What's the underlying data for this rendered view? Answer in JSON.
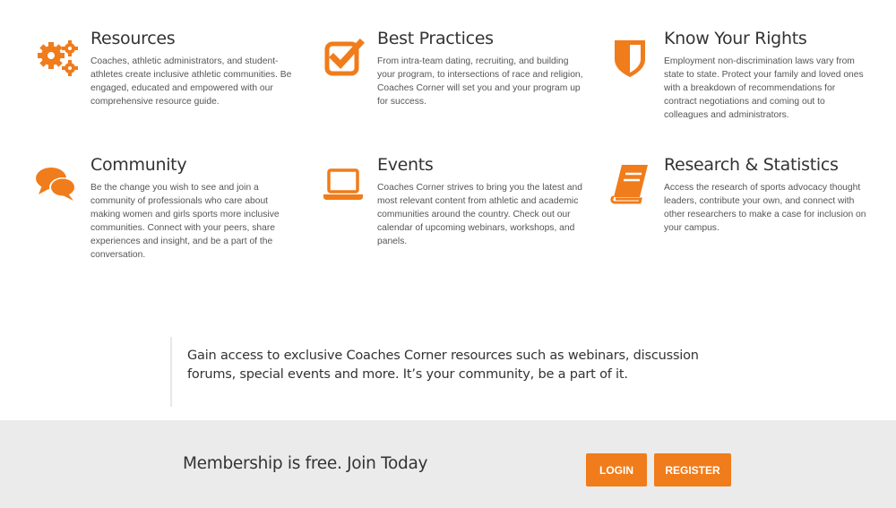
{
  "theme": {
    "accent": "#f07c1b"
  },
  "features": [
    {
      "icon": "gears-icon",
      "title": "Resources",
      "text": "Coaches, athletic administrators, and student-athletes create inclusive athletic communities.  Be engaged, educated and empowered with our comprehensive resource guide."
    },
    {
      "icon": "checkbox-icon",
      "title": "Best Practices",
      "text": "From intra-team dating, recruiting, and building your program, to intersections of race and religion, Coaches Corner will set you and your program up for success."
    },
    {
      "icon": "shield-icon",
      "title": "Know Your Rights",
      "text": "Employment non-discrimination laws vary from state to state. Protect your family and loved ones with a breakdown of recommendations for contract negotiations and coming out to colleagues and administrators."
    },
    {
      "icon": "chat-bubbles-icon",
      "title": "Community",
      "text": "Be the change you wish to see and join a community of professionals who care about making women and girls sports more inclusive communities. Connect with your peers, share experiences and insight, and be a part of the conversation."
    },
    {
      "icon": "laptop-icon",
      "title": "Events",
      "text": "Coaches Corner strives to bring you the latest and most relevant content from athletic and academic communities around the country. Check out our calendar of upcoming webinars, workshops, and panels."
    },
    {
      "icon": "book-icon",
      "title": "Research & Statistics",
      "text": "Access the research of sports advocacy thought leaders, contribute your own, and connect with other researchers to make a case for inclusion on your campus."
    }
  ],
  "cta": {
    "text": "Gain access to exclusive Coaches Corner resources such as webinars, discussion forums, special events and more. It’s your community, be a part of it."
  },
  "join": {
    "text": "Membership is free. Join Today",
    "login_label": "LOGIN",
    "register_label": "REGISTER"
  }
}
